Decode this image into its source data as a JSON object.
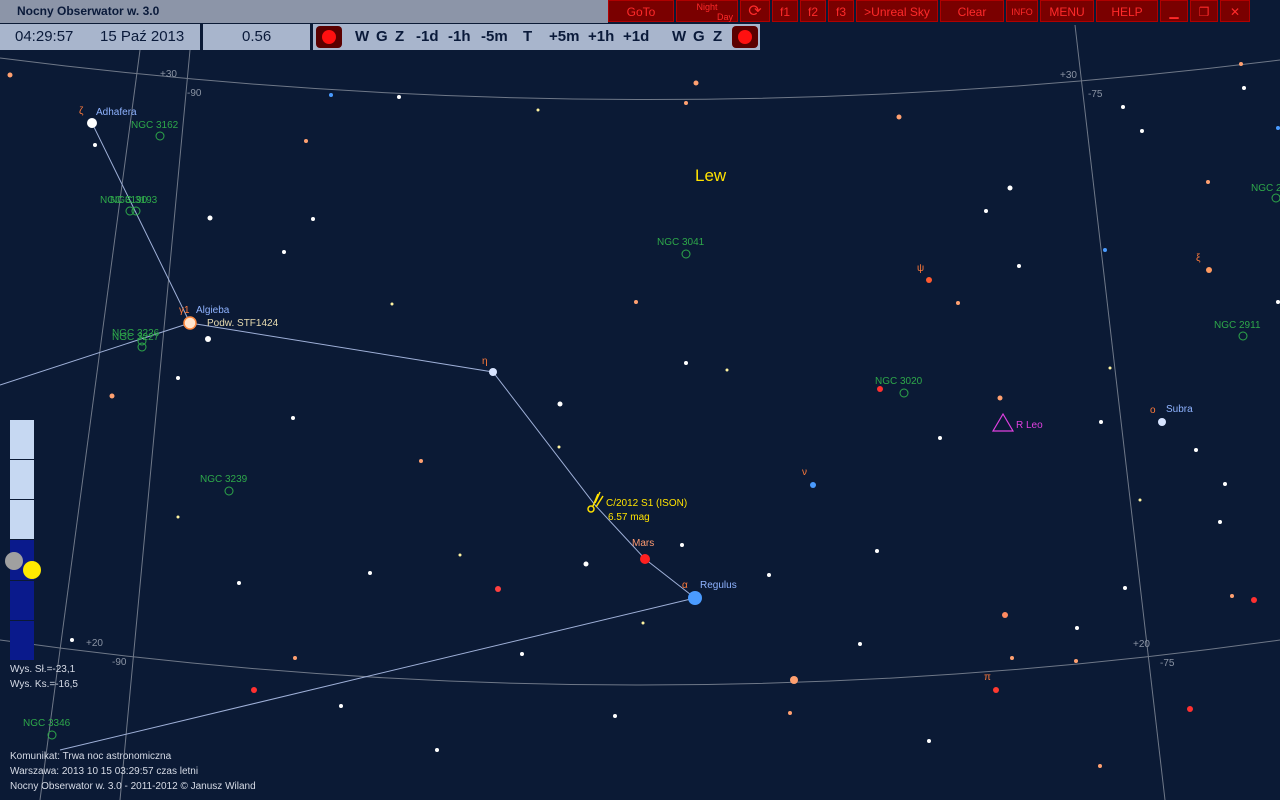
{
  "app": {
    "title": "Nocny Obserwator w. 3.0"
  },
  "toolbar": {
    "goto": "GoTo",
    "night": "Night",
    "day": "Day",
    "f1": "f1",
    "f2": "f2",
    "f3": "f3",
    "unreal": ">Unreal Sky",
    "clear": "Clear",
    "info": "INFO",
    "menu": "MENU",
    "help": "HELP"
  },
  "timebar": {
    "time": "04:29:57",
    "date": "15 Paź 2013",
    "value": "0.56",
    "w1": "W",
    "g1": "G",
    "z1": "Z",
    "m1d": "-1d",
    "m1h": "-1h",
    "m5m": "-5m",
    "t": "T",
    "p5m": "+5m",
    "p1h": "+1h",
    "p1d": "+1d",
    "w2": "W",
    "g2": "G",
    "z2": "Z"
  },
  "sky": {
    "constellation": "Lew",
    "grid": {
      "dec30_left": "+30",
      "dec30_right": "+30",
      "dec20_left": "+20",
      "dec20_right": "+20",
      "ra90_top": "-90",
      "ra75_top": "-75",
      "ra90_bot": "-90",
      "ra75_bot": "-75"
    },
    "stars": {
      "adhafera": "Adhafera",
      "algieba": "Algieba",
      "stf": "Podw. STF1424",
      "regulus": "Regulus",
      "subra": "Subra",
      "mars": "Mars",
      "rleo": "R Leo"
    },
    "greek": {
      "zeta": "ζ",
      "gamma1": "γ1",
      "eta": "η",
      "alpha": "α",
      "psi": "ψ",
      "xi": "ξ",
      "nu": "ν",
      "omicron": "ο",
      "pi": "π"
    },
    "comet": {
      "name": "C/2012 S1 (ISON)",
      "mag": "6.57 mag"
    },
    "ngc": {
      "n3162": "NGC 3162",
      "n3190": "NGC 3190",
      "n3193": "NGC 3193",
      "n3226": "NGC 3226",
      "n3227": "NGC 3227",
      "n3041": "NGC 3041",
      "n3020": "NGC 3020",
      "n3239": "NGC 3239",
      "n2911": "NGC 2911",
      "n2edge": "NGC 2",
      "n3346": "NGC 3346"
    }
  },
  "status": {
    "sun_alt": "Wys. Sł.=-23,1",
    "moon_alt": "Wys. Ks.=-16,5",
    "message": "Komunikat: Trwa noc astronomiczna",
    "location": "Warszawa:  2013 10 15  03:29:57 czas letni",
    "copyright": "Nocny Obserwator w. 3.0 - 2011-2012 © Janusz Wiland"
  },
  "colors": {
    "sky": "#0b1a35",
    "button_bg": "#7a0000",
    "button_text": "#ff2a2a",
    "ngc": "#2ea84a",
    "label": "#8fb3ff",
    "comet": "#ffe200"
  }
}
